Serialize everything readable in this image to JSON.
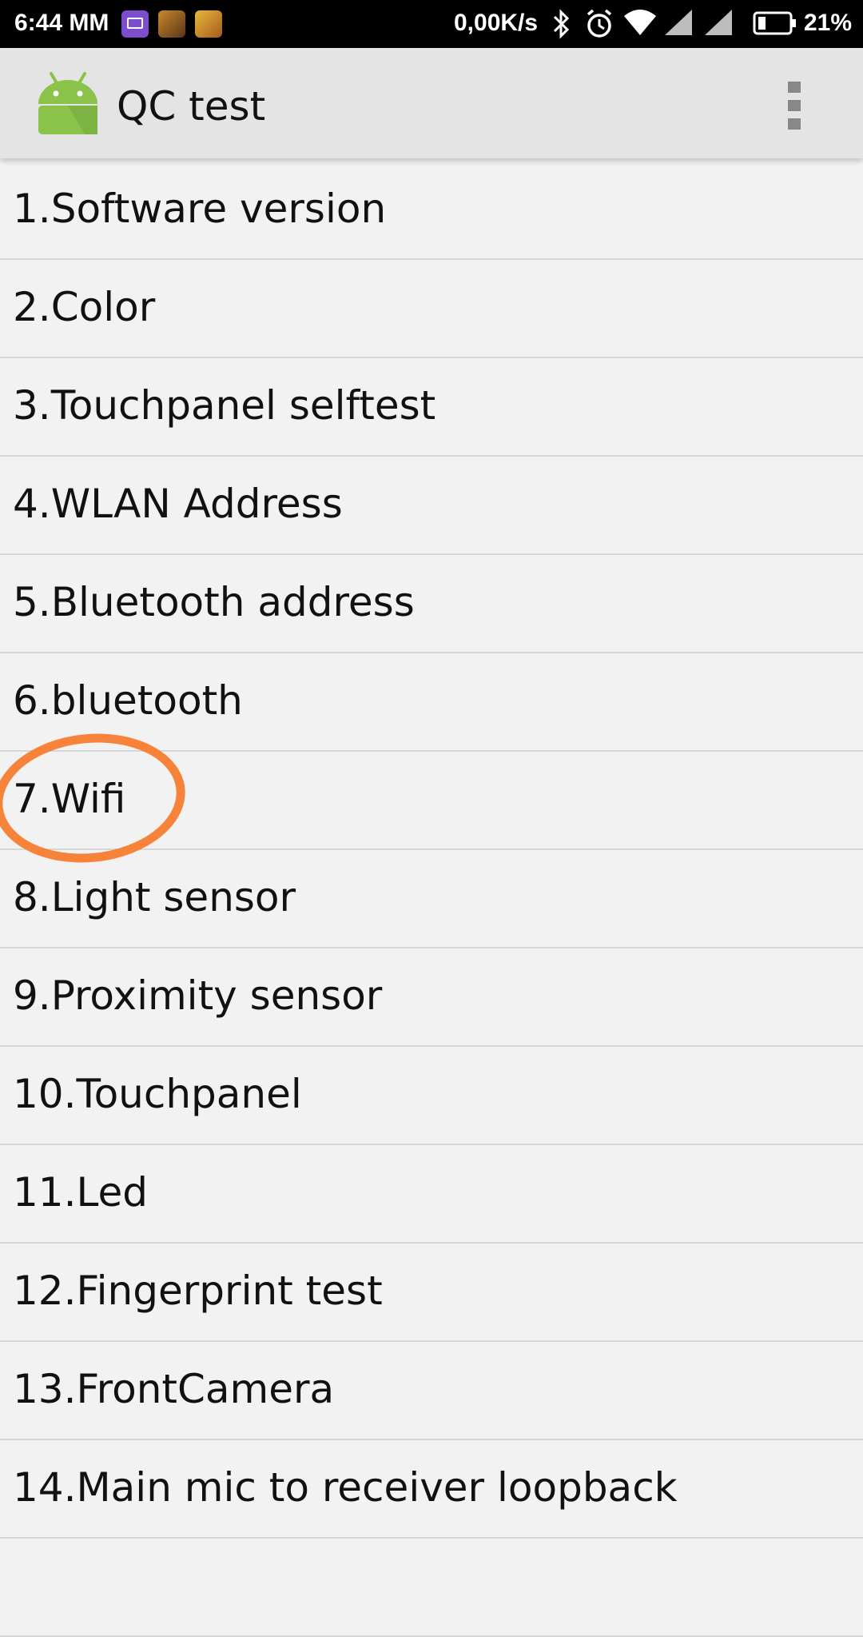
{
  "status_bar": {
    "time": "6:44 MM",
    "net_speed": "0,00K/s",
    "battery_percent": "21%",
    "notification_icons": [
      "mail-app-icon",
      "game-app-icon",
      "game-app-icon"
    ],
    "status_icons": [
      "bluetooth-icon",
      "alarm-icon",
      "wifi-icon",
      "signal-icon",
      "signal-icon",
      "battery-icon"
    ]
  },
  "action_bar": {
    "title": "QC test",
    "app_icon": "android-robot-icon",
    "overflow_icon": "overflow-menu-icon"
  },
  "items": [
    {
      "label": "1.Software version"
    },
    {
      "label": "2.Color"
    },
    {
      "label": "3.Touchpanel selftest"
    },
    {
      "label": "4.WLAN Address"
    },
    {
      "label": "5.Bluetooth address"
    },
    {
      "label": "6.bluetooth"
    },
    {
      "label": "7.Wifi"
    },
    {
      "label": "8.Light sensor"
    },
    {
      "label": "9.Proximity sensor"
    },
    {
      "label": "10.Touchpanel"
    },
    {
      "label": "11.Led"
    },
    {
      "label": "12.Fingerprint test"
    },
    {
      "label": "13.FrontCamera"
    },
    {
      "label": "14.Main mic to receiver loopback"
    },
    {
      "label": ""
    }
  ],
  "colors": {
    "annotation_circle": "#f7823a",
    "android_green": "#8bc34a"
  }
}
